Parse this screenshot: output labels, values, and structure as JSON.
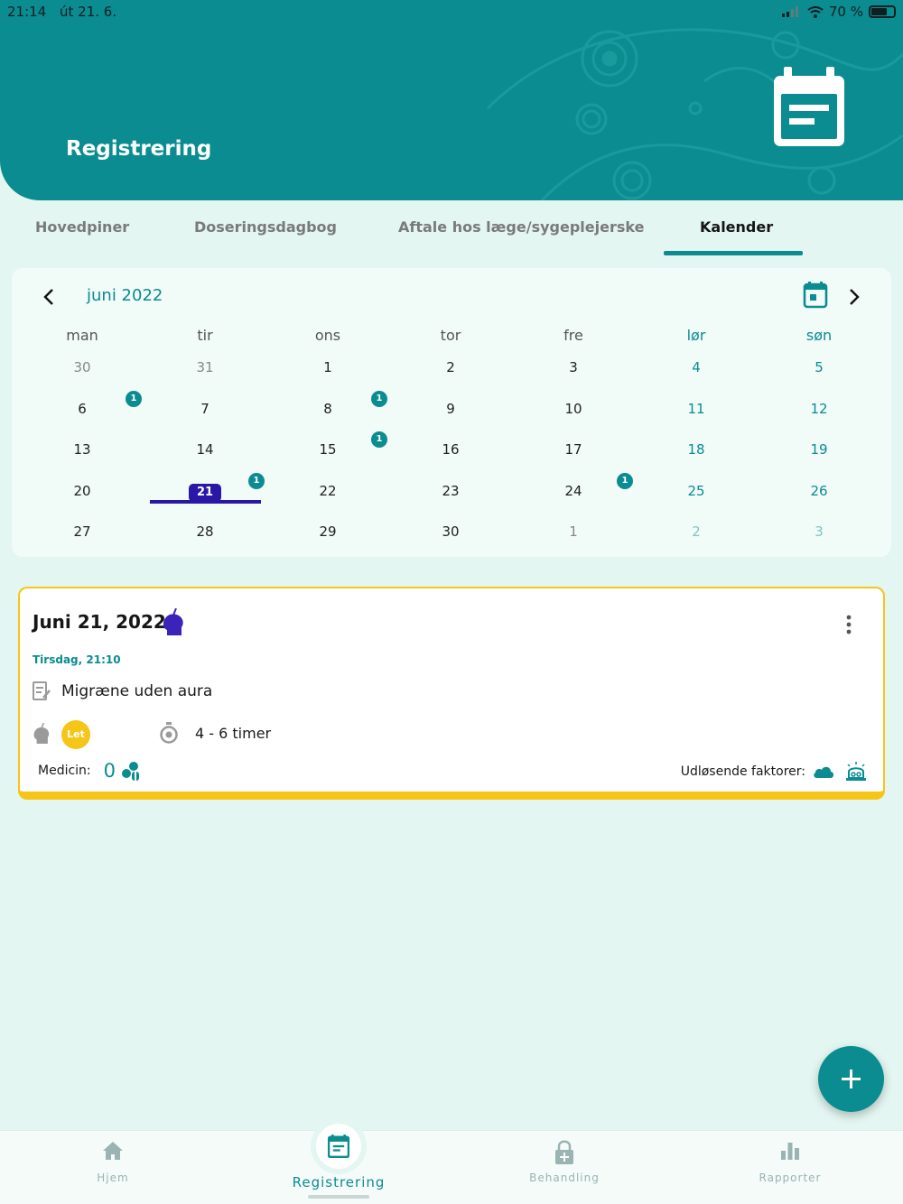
{
  "status_bar": {
    "time": "21:14",
    "date": "út 21. 6.",
    "battery": "70 %",
    "battery_level": 0.7
  },
  "header": {
    "title": "Registrering",
    "icon": "calendar-note-icon"
  },
  "tabs": [
    {
      "label": "Hovedpiner",
      "active": false
    },
    {
      "label": "Doseringsdagbog",
      "active": false
    },
    {
      "label": "Aftale hos læge/sygeplejerske",
      "active": false
    },
    {
      "label": "Kalender",
      "active": true
    }
  ],
  "calendar": {
    "month_label": "juni 2022",
    "weekdays": [
      "man",
      "tir",
      "ons",
      "tor",
      "fre",
      "lør",
      "søn"
    ],
    "weeks": [
      [
        "30",
        "31",
        "1",
        "2",
        "3",
        "4",
        "5"
      ],
      [
        "6",
        "7",
        "8",
        "9",
        "10",
        "11",
        "12"
      ],
      [
        "13",
        "14",
        "15",
        "16",
        "17",
        "18",
        "19"
      ],
      [
        "20",
        "21",
        "22",
        "23",
        "24",
        "25",
        "26"
      ],
      [
        "27",
        "28",
        "29",
        "30",
        "1",
        "2",
        "3"
      ]
    ],
    "today": "21",
    "event_count_label": "1"
  },
  "event_card": {
    "date": "Juni 21, 2022",
    "weekday_time": "Tirsdag, 21:10",
    "type": "Migræne uden aura",
    "intensity": "Let",
    "duration": "4 - 6 timer",
    "medicine_label": "Medicin:",
    "medicine_count": "0",
    "triggers_label": "Udløsende faktorer:",
    "accent": "#f5c518"
  },
  "fab": {
    "icon": "plus-icon"
  },
  "bottom_nav": [
    {
      "label": "Hjem",
      "icon": "home-icon",
      "active": false
    },
    {
      "label": "Registrering",
      "icon": "calendar-note-icon",
      "active": true
    },
    {
      "label": "Behandling",
      "icon": "lock-plus-icon",
      "active": false
    },
    {
      "label": "Rapporter",
      "icon": "bar-chart-icon",
      "active": false
    }
  ],
  "colors": {
    "primary": "#0a8c91",
    "today": "#2a17a6",
    "background": "#e3f6f1"
  }
}
